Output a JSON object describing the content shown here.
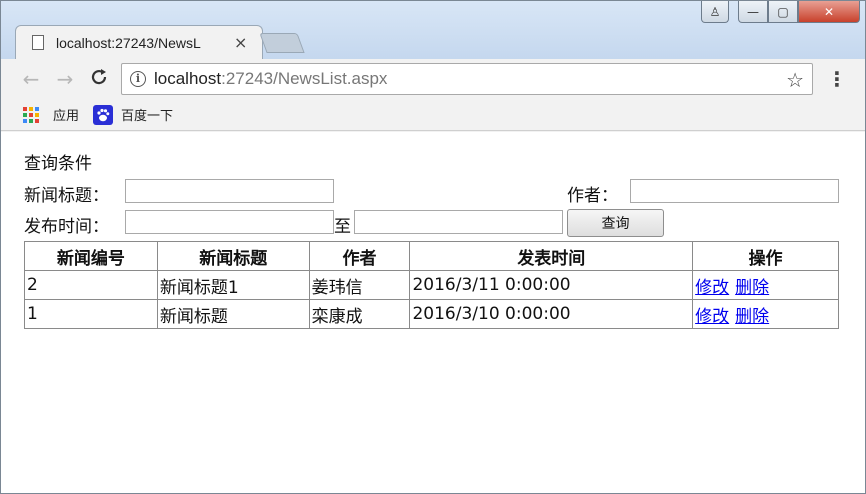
{
  "browser": {
    "tab_title": "localhost:27243/NewsL",
    "tab_close": "×",
    "url_host": "localhost",
    "url_rest": ":27243/NewsList.aspx",
    "back_glyph": "←",
    "forward_glyph": "→",
    "reload_glyph": "C",
    "star_glyph": "☆",
    "menu_glyph": "⋮",
    "info_glyph": "i",
    "window_close": "✕",
    "window_min": "—",
    "window_max": "▢",
    "window_user": "♙"
  },
  "bookmarks": {
    "apps_label": "应用",
    "baidu_label": "百度一下",
    "baidu_glyph": "🐾",
    "apps_colors": [
      "#e44134",
      "#f6b400",
      "#3d8af7",
      "#2aa952",
      "#e44134",
      "#f6b400",
      "#3d8af7",
      "#2aa952",
      "#e44134"
    ]
  },
  "form": {
    "section_title": "查询条件",
    "title_label": "新闻标题：",
    "title_value": "",
    "author_label": "作者：",
    "author_value": "",
    "time_label": "发布时间：",
    "time_from_value": "",
    "time_to_label": "至",
    "time_to_value": "",
    "query_button": "查询"
  },
  "table": {
    "headers": [
      "新闻编号",
      "新闻标题",
      "作者",
      "发表时间",
      "操作"
    ],
    "edit_label": "修改",
    "delete_label": "删除",
    "rows": [
      {
        "id": "2",
        "title": "新闻标题1",
        "author": "姜玮信",
        "time": "2016/3/11 0:00:00"
      },
      {
        "id": "1",
        "title": "新闻标题",
        "author": "栾康成",
        "time": "2016/3/10 0:00:00"
      }
    ]
  },
  "colors": {
    "link": "#0000ee",
    "titlebar": "#c4d7ee",
    "close_button": "#c8412c"
  }
}
